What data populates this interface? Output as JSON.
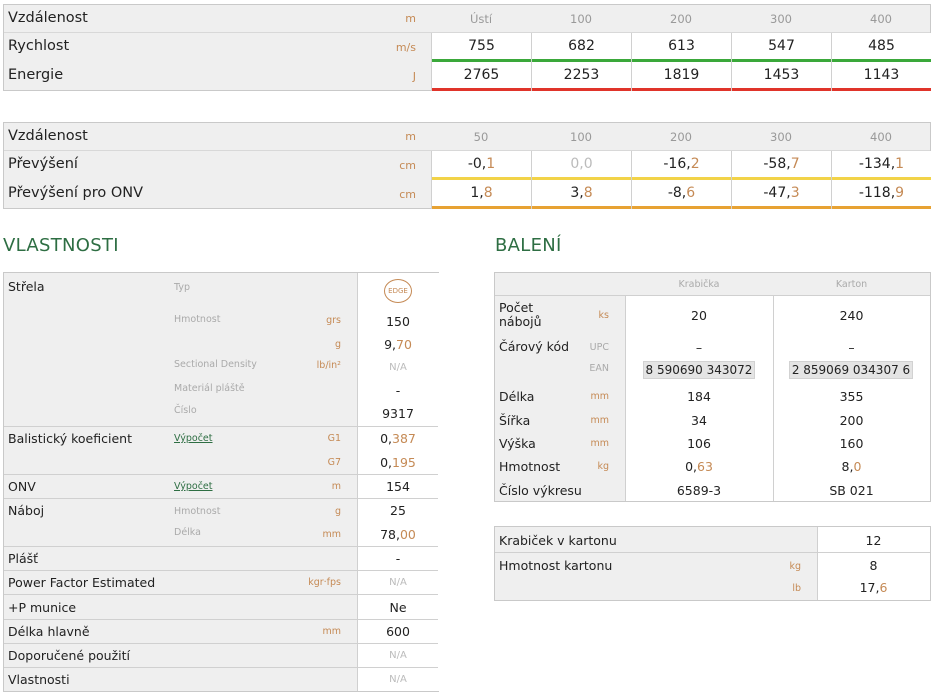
{
  "ballistic1": {
    "dist_label": "Vzdálenost",
    "dist_unit": "m",
    "dist_cols": [
      "Ústí",
      "100",
      "200",
      "300",
      "400"
    ],
    "speed_label": "Rychlost",
    "speed_unit": "m/s",
    "speed_vals": [
      "755",
      "682",
      "613",
      "547",
      "485"
    ],
    "energy_label": "Energie",
    "energy_unit": "J",
    "energy_vals": [
      "2765",
      "2253",
      "1819",
      "1453",
      "1143"
    ],
    "speed_bar_color": "#3aa83a",
    "energy_bar_color": "#e0342a"
  },
  "ballistic2": {
    "dist_label": "Vzdálenost",
    "dist_unit": "m",
    "dist_cols": [
      "50",
      "100",
      "200",
      "300",
      "400"
    ],
    "drop_label": "Převýšení",
    "drop_unit": "cm",
    "drop_int": [
      "-0,",
      "0,",
      "-16,",
      "-58,",
      "-134,"
    ],
    "drop_frac": [
      "1",
      "0",
      "2",
      "7",
      "1"
    ],
    "onv_label": "Převýšení pro ONV",
    "onv_unit": "cm",
    "onv_int": [
      "1,",
      "3,",
      "-8,",
      "-47,",
      "-118,"
    ],
    "onv_frac": [
      "8",
      "8",
      "6",
      "3",
      "9"
    ],
    "drop_bar_color": "#f2d348",
    "onv_bar_color": "#e7a233"
  },
  "vlastnosti": {
    "title": "VLASTNOSTI",
    "strela_label": "Střela",
    "typ_label": "Typ",
    "typ_badge": "EDGE",
    "hmotnost_label": "Hmotnost",
    "hmotnost_unit_grs": "grs",
    "hmotnost_grs": "150",
    "hmotnost_unit_g": "g",
    "hmotnost_g_int": "9,",
    "hmotnost_g_frac": "70",
    "sd_label": "Sectional Density",
    "sd_unit": "lb/in²",
    "sd_val": "N/A",
    "material_label": "Materiál pláště",
    "material_val": "-",
    "cislo_label": "Číslo",
    "cislo_val": "9317",
    "bk_label": "Balistický koeficient",
    "bk_link": "Výpočet",
    "g1_label": "G1",
    "g1_int": "0,",
    "g1_frac": "387",
    "g7_label": "G7",
    "g7_int": "0,",
    "g7_frac": "195",
    "onv_label": "ONV",
    "onv_link": "Výpočet",
    "onv_unit": "m",
    "onv_val": "154",
    "naboj_label": "Náboj",
    "naboj_hm_label": "Hmotnost",
    "naboj_hm_unit": "g",
    "naboj_hm_val": "25",
    "naboj_delka_label": "Délka",
    "naboj_delka_unit": "mm",
    "naboj_delka_int": "78,",
    "naboj_delka_frac": "00",
    "plast_label": "Plášť",
    "plast_val": "-",
    "pfe_label": "Power Factor Estimated",
    "pfe_unit": "kgr·fps",
    "pfe_val": "N/A",
    "pmunice_label": "+P munice",
    "pmunice_val": "Ne",
    "hlaven_label": "Délka hlavně",
    "hlaven_unit": "mm",
    "hlaven_val": "600",
    "pouziti_label": "Doporučené použití",
    "pouziti_val": "N/A",
    "vlastnosti_label": "Vlastnosti",
    "vlastnosti_val": "N/A"
  },
  "baleni": {
    "title": "BALENÍ",
    "col1": "Krabička",
    "col2": "Karton",
    "pocet_label": "Počet nábojů",
    "pocet_unit": "ks",
    "pocet1": "20",
    "pocet2": "240",
    "kod_label": "Čárový kód",
    "upc_label": "UPC",
    "upc1": "–",
    "upc2": "–",
    "ean_label": "EAN",
    "ean1": "8 590690 343072",
    "ean2": "2 859069 034307 6",
    "delka_label": "Délka",
    "delka_unit": "mm",
    "delka1": "184",
    "delka2": "355",
    "sirka_label": "Šířka",
    "sirka_unit": "mm",
    "sirka1": "34",
    "sirka2": "200",
    "vyska_label": "Výška",
    "vyska_unit": "mm",
    "vyska1": "106",
    "vyska2": "160",
    "hm_label": "Hmotnost",
    "hm_unit": "kg",
    "hm1_int": "0,",
    "hm1_frac": "63",
    "hm2_int": "8,",
    "hm2_frac": "0",
    "vykres_label": "Číslo výkresu",
    "vykres1": "6589-3",
    "vykres2": "SB 021"
  },
  "karton": {
    "krabicek_label": "Krabiček v kartonu",
    "krabicek_val": "12",
    "hm_label": "Hmotnost kartonu",
    "hm_unit_kg": "kg",
    "hm_kg": "8",
    "hm_unit_lb": "lb",
    "hm_lb_int": "17,",
    "hm_lb_frac": "6"
  }
}
